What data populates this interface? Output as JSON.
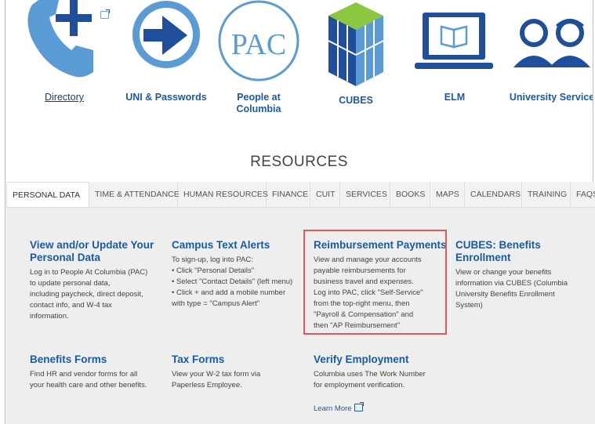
{
  "icons": {
    "directory": "Directory",
    "uni": "UNI & Passwords",
    "pac_line1": "People at",
    "pac_line2": "Columbia",
    "pac_logo": "PAC",
    "cubes": "CUBES",
    "elm": "ELM",
    "university": "University Services"
  },
  "resources_title": "RESOURCES",
  "tabs": [
    "PERSONAL DATA",
    "TIME & ATTENDANCE",
    "HUMAN RESOURCES",
    "FINANCE",
    "CUIT",
    "SERVICES",
    "BOOKS",
    "MAPS",
    "CALENDARS",
    "TRAINING",
    "FAQS"
  ],
  "cards": {
    "view_update": {
      "title1": "View and/or Update Your",
      "title2": "Personal Data",
      "lines": [
        "Log in to People At Columbia (PAC)",
        "to update personal data,",
        "including paycheck, direct deposit,",
        "contact info, and W-4 tax",
        "information."
      ]
    },
    "campus_text": {
      "title": "Campus Text Alerts",
      "lines": [
        "To sign-up, log into PAC:",
        "• Click \"Personal Details\"",
        "• Select \"Contact Details\" (left menu)",
        "• Click +  and add a mobile number",
        "with type = \"Campus Alert\""
      ]
    },
    "reimbursement": {
      "title": "Reimbursement Payments",
      "lines": [
        "View and manage your accounts",
        "payable reimbursements for",
        "business travel and expenses.",
        "Log into PAC, click \"Self-Service\"",
        "from the top-right menu, then",
        "\"Payroll & Compensation\" and",
        "then \"AP Reimbursement\""
      ]
    },
    "cubes": {
      "title1": "CUBES: Benefits",
      "title2": "Enrollment",
      "lines": [
        "View or change your benefits",
        "information via CUBES (Columbia",
        "University Benefits Enrollment",
        "System)"
      ]
    },
    "benefits_forms": {
      "title": "Benefits Forms",
      "lines": [
        "Find HR and vendor forms for all",
        "your health care and other benefits."
      ]
    },
    "tax_forms": {
      "title": "Tax Forms",
      "lines": [
        "View your W-2 tax form via",
        "Paperless Employee."
      ]
    },
    "verify": {
      "title": "Verify Employment",
      "lines": [
        "Columbia uses The Work Number",
        "for employment verification."
      ],
      "learn_more": "Learn More"
    }
  },
  "colors": {
    "accent": "#1b5aa8",
    "icon_blue": "#5b9bd5",
    "icon_dark": "#1f4e9c",
    "highlight": "#e05959"
  }
}
